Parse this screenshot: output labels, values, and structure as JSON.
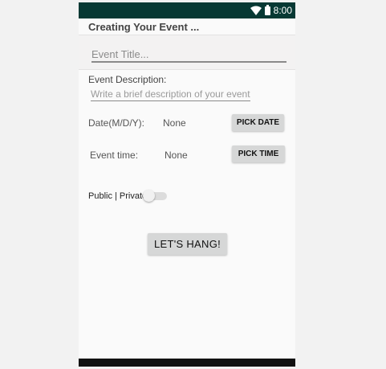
{
  "status_bar": {
    "time": "8:00"
  },
  "app": {
    "title": "Creating Your Event ..."
  },
  "form": {
    "title_placeholder": "Event Title...",
    "description_label": "Event Description:",
    "description_placeholder": "Write a brief description of your event",
    "date_label": "Date(M/D/Y):",
    "date_value": "None",
    "pick_date_label": "PICK DATE",
    "time_label": "Event time:",
    "time_value": "None",
    "pick_time_label": "PICK TIME",
    "visibility_label": "Public | Private",
    "submit_label": "LET'S HANG!"
  },
  "colors": {
    "status_bar": "#073934",
    "button": "#d6d7d7",
    "background": "#fafafa"
  }
}
